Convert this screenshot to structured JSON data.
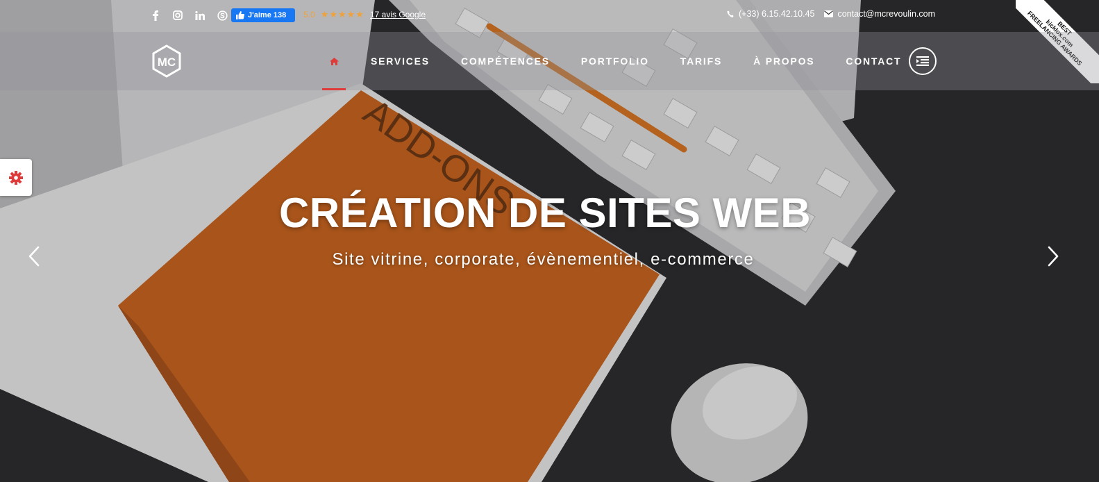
{
  "topbar": {
    "social": [
      {
        "name": "facebook-icon",
        "glyph": "f"
      },
      {
        "name": "instagram-icon",
        "glyph": "instagram"
      },
      {
        "name": "linkedin-icon",
        "glyph": "in"
      },
      {
        "name": "skype-icon",
        "glyph": "S"
      }
    ],
    "fb_like_label": "J'aime 138",
    "rating_score": "5.0",
    "rating_stars": "★★★★★",
    "reviews_link": "17 avis Google",
    "phone": "(+33) 6.15.42.10.45",
    "email": "contact@mcrevoulin.com"
  },
  "ribbon": {
    "line1": "BEST",
    "line2": "kicklox.com",
    "line3": "FREELANCING AWARDS"
  },
  "nav": {
    "logo_text": "MC",
    "items": [
      "SERVICES",
      "COMPÉTENCES",
      "PORTFOLIO",
      "TARIFS",
      "À PROPOS",
      "CONTACT"
    ]
  },
  "hero": {
    "title": "CRÉATION DE SITES WEB",
    "subtitle": "Site vitrine, corporate, évènementiel, e-commerce",
    "book_text": "ADD-ONS"
  },
  "colors": {
    "accent": "#e03b3b",
    "facebook": "#1877f2",
    "stars": "#f0a23a",
    "book_orange": "#c8621c"
  }
}
